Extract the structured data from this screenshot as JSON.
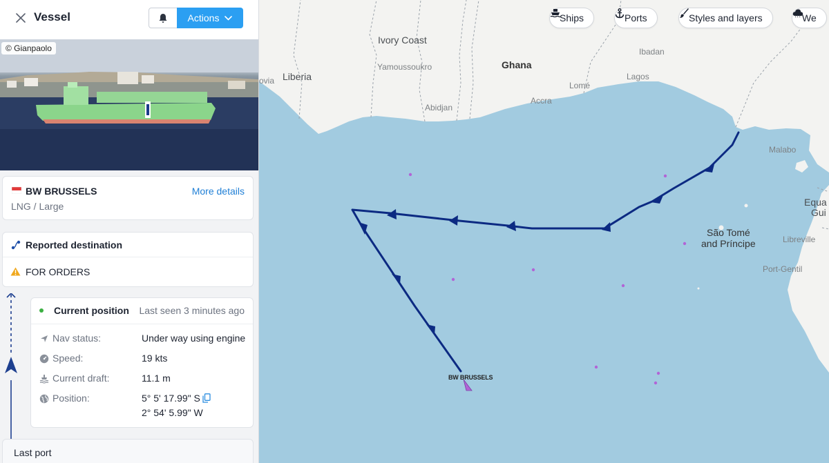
{
  "panel": {
    "title": "Vessel",
    "actions_label": "Actions",
    "photo_credit": "© Gianpaolo"
  },
  "vessel": {
    "name": "BW BRUSSELS",
    "type": "LNG / Large",
    "more_details_label": "More details"
  },
  "destination": {
    "title": "Reported destination",
    "value": "FOR ORDERS"
  },
  "current_position": {
    "title": "Current position",
    "last_seen": "Last seen 3 minutes ago",
    "rows": [
      {
        "label": "Nav status",
        "value": "Under way using engine"
      },
      {
        "label": "Speed",
        "value": "19 kts"
      },
      {
        "label": "Current draft",
        "value": "11.1 m"
      },
      {
        "label": "Position",
        "value": "5° 5' 17.99\" S",
        "value2": "2° 54' 5.99\" W"
      }
    ]
  },
  "last_port": {
    "label": "Last port"
  },
  "map": {
    "toolbar": [
      "Ships",
      "Ports",
      "Styles and layers",
      "We"
    ],
    "countries": [
      "Ivory Coast",
      "Ghana",
      "Liberia",
      "São Tomé",
      "and Príncipe",
      "Equa",
      "Gui"
    ],
    "cities": [
      "Yamoussoukro",
      "Ibadan",
      "Lagos",
      "Lomé",
      "Accra",
      "Abidjan",
      "Malabo",
      "Libreville",
      "Port-Gentil",
      "ovia"
    ],
    "ship_label": "BW BRUSSELS"
  },
  "colors": {
    "accent": "#2b9ff2",
    "link": "#1f7fd6",
    "ocean": "#a2cbe0",
    "land": "#f3f3f1",
    "track": "#0c2a82",
    "ship": "#b164d6"
  }
}
